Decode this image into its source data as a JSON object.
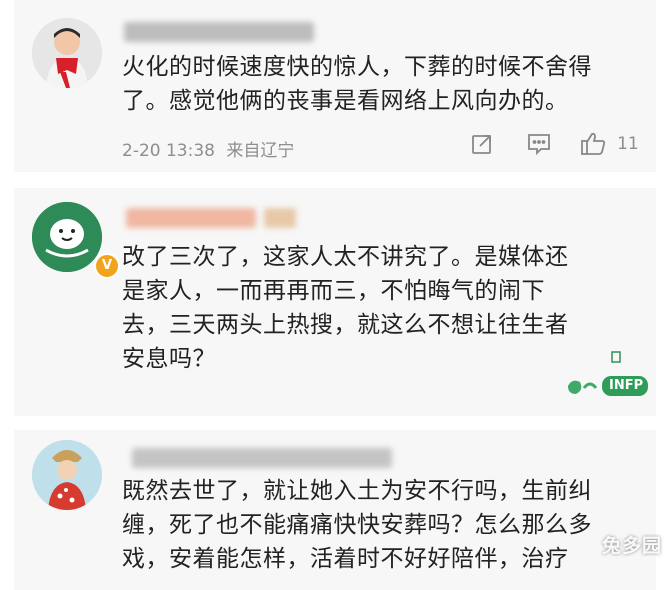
{
  "comments": [
    {
      "lines": [
        "火化的时候速度快的惊人，下葬的时候不舍得",
        "了。感觉他俩的丧事是看网络上风向办的。"
      ],
      "date": "2-20 13:38",
      "location": "来自辽宁",
      "likes": "11"
    },
    {
      "lines": [
        "改了三次了，这家人太不讲究了。是媒体还",
        "是家人，一而再再而三，不怕晦气的闹下",
        "去，三天两头上热搜，就这么不想让往生者",
        "安息吗？"
      ],
      "badge": "V",
      "sticker": "INFP"
    },
    {
      "lines": [
        "既然去世了，就让她入土为安不行吗，生前纠",
        "缠，死了也不能痛痛快快安葬吗？怎么那么多",
        "戏，安着能怎样，活着时不好好陪伴，治疗"
      ]
    }
  ],
  "watermark": "兔多园",
  "icons": [
    "share-icon",
    "comment-icon",
    "like-icon",
    "verified-badge-icon"
  ]
}
